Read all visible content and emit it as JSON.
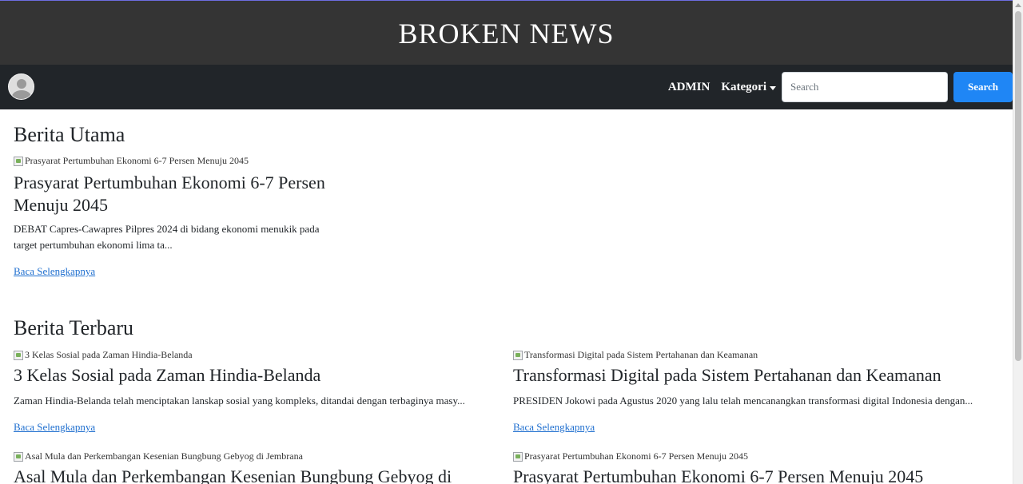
{
  "site": {
    "brand": "BROKEN NEWS"
  },
  "nav": {
    "admin": "ADMIN",
    "kategori": "Kategori",
    "search_placeholder": "Search",
    "search_button": "Search"
  },
  "featured": {
    "heading": "Berita Utama",
    "image_alt": "Prasyarat Pertumbuhan Ekonomi 6-7 Persen Menuju 2045",
    "title": "Prasyarat Pertumbuhan Ekonomi 6-7 Persen Menuju 2045",
    "excerpt": "DEBAT Capres-Cawapres Pilpres 2024 di bidang ekonomi menukik pada target pertumbuhan ekonomi lima ta...",
    "read_more": "Baca Selengkapnya"
  },
  "latest": {
    "heading": "Berita Terbaru",
    "articles": [
      {
        "image_alt": "3 Kelas Sosial pada Zaman Hindia-Belanda",
        "title": "3 Kelas Sosial pada Zaman Hindia-Belanda",
        "excerpt": "Zaman Hindia-Belanda telah menciptakan lanskap sosial yang kompleks, ditandai dengan terbaginya masy...",
        "read_more": "Baca Selengkapnya"
      },
      {
        "image_alt": "Transformasi Digital pada Sistem Pertahanan dan Keamanan",
        "title": "Transformasi Digital pada Sistem Pertahanan dan Keamanan",
        "excerpt": "PRESIDEN Jokowi pada Agustus 2020 yang lalu telah mencanangkan transformasi digital Indonesia dengan...",
        "read_more": "Baca Selengkapnya"
      },
      {
        "image_alt": "Asal Mula dan Perkembangan Kesenian Bungbung Gebyog di Jembrana",
        "title": "Asal Mula dan Perkembangan Kesenian Bungbung Gebyog di"
      },
      {
        "image_alt": "Prasyarat Pertumbuhan Ekonomi 6-7 Persen Menuju 2045",
        "title": "Prasyarat Pertumbuhan Ekonomi 6-7 Persen Menuju 2045"
      }
    ]
  }
}
